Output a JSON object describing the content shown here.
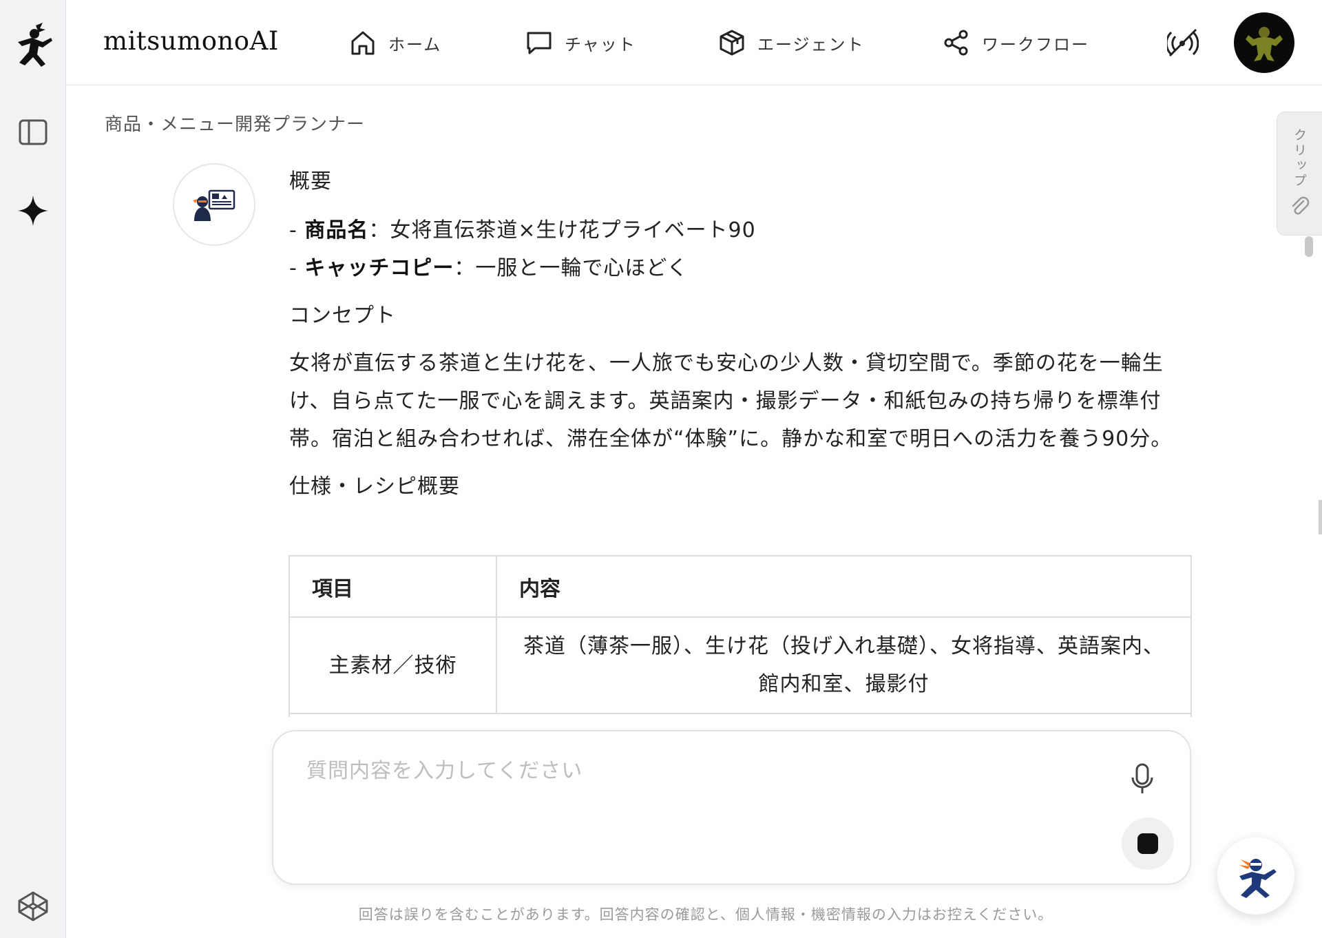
{
  "app": {
    "brand": "mitsumonoAI"
  },
  "nav": {
    "items": [
      {
        "label": "ホーム",
        "icon": "home-icon"
      },
      {
        "label": "チャット",
        "icon": "chat-icon"
      },
      {
        "label": "エージェント",
        "icon": "cube-icon"
      },
      {
        "label": "ワークフロー",
        "icon": "share-nodes-icon"
      }
    ],
    "broadcast_icon": "broadcast-icon",
    "avatar_icon": "user-avatar"
  },
  "sidebar": {
    "icons": [
      "ninja-logo-icon",
      "sidebar-toggle-icon",
      "sparkle-icon",
      "codepen-cube-icon"
    ]
  },
  "page": {
    "title": "商品・メニュー開発プランナー"
  },
  "message": {
    "overview_heading": "概要",
    "product_name_label": "商品名",
    "product_name_value": "：女将直伝茶道×生け花プライベート90",
    "catchcopy_label": "キャッチコピー",
    "catchcopy_value": "：一服と一輪で心ほどく",
    "concept_heading": "コンセプト",
    "concept_body": "女将が直伝する茶道と生け花を、一人旅でも安心の少人数・貸切空間で。季節の花を一輪生け、自ら点てた一服で心を調えます。英語案内・撮影データ・和紙包みの持ち帰りを標準付帯。宿泊と組み合わせれば、滞在全体が“体験”に。静かな和室で明日への活力を養う90分。",
    "spec_heading": "仕様・レシピ概要",
    "table": {
      "headers": [
        "項目",
        "内容"
      ],
      "rows": [
        [
          "主素材／技術",
          "茶道（薄茶一服）、生け花（投げ入れ基礎）、女将指導、英語案内、館内和室、撮影付"
        ]
      ]
    }
  },
  "clip": {
    "label": "クリップ"
  },
  "input": {
    "placeholder": "質問内容を入力してください",
    "value": ""
  },
  "footer": {
    "disclaimer": "回答は誤りを含むことがあります。回答内容の確認と、個人情報・機密情報の入力はお控えください。"
  },
  "colors": {
    "rail_bg": "#f1f2f4",
    "accent_dark": "#111111",
    "fab_ninja_blue": "#1f3a7a",
    "fab_ninja_orange": "#f07a2a"
  }
}
